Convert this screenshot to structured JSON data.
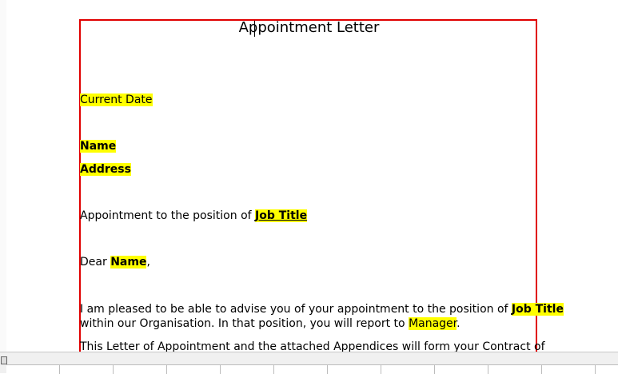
{
  "document": {
    "title": "Appointment Letter",
    "date_field": "Current Date",
    "name_field": "Name",
    "address_field": "Address",
    "subject_prefix": "Appointment to the position of ",
    "job_title_field": "Job Title",
    "salutation_prefix": "Dear ",
    "salutation_suffix": ",",
    "body_1_prefix": "I am pleased to be able to advise you of your appointment to the position of ",
    "body_2_prefix": "within our Organisation. In that position, you will report to ",
    "manager_field": "Manager",
    "body_2_suffix": ".",
    "body_3": "This Letter of Appointment and the attached Appendices will form your Contract of"
  },
  "colors": {
    "highlight": "#ffff00",
    "page_border": "#e00000"
  },
  "icons": {
    "status": "document-view-icon"
  }
}
